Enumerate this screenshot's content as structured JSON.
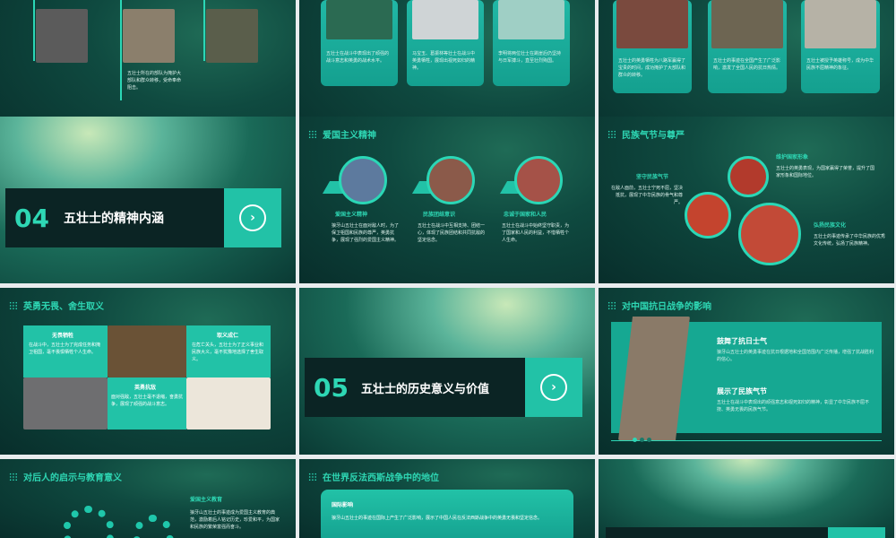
{
  "slides": {
    "s1": {
      "text": "五壮士所在的部队为掩护大部队和群众转移，受命奉命阻击。"
    },
    "s2": {
      "cards": [
        "五壮士在战斗中表现出了顽强的战斗意志和英勇的战术水平。",
        "马宝玉、葛振林等壮士在战斗中英勇牺牲，展现出视死如归的精神。",
        "李明将两位壮士在跳崖后仍坚持与日军搏斗，直至壮烈殉国。"
      ]
    },
    "s3": {
      "cards": [
        "五壮士的英勇牺牲为八路军赢得了宝贵的时间，成功掩护了大部队和群众的转移。",
        "五壮士的事迹在全国产生了广泛影响，激发了全国人民的抗日热情。",
        "五壮士被授予英雄称号，成为中华民族不屈精神的象征。"
      ]
    },
    "s4": {
      "number": "04",
      "title": "五壮士的精神内涵"
    },
    "s5": {
      "header": "爱国主义精神",
      "cols": [
        {
          "label": "爱国主义精神",
          "text": "狼牙山五壮士在面对敌人时，为了保卫祖国和民族的尊严，英勇抗争，展现了强烈的爱国主义精神。"
        },
        {
          "label": "民族团结意识",
          "text": "五壮士在战斗中互相支持、团结一心，体现了民族团结和共同抗敌的坚定信念。"
        },
        {
          "label": "忠诚于国家和人民",
          "text": "五壮士在战斗中始终坚守职责，为了国家和人民的利益，不惜牺牲个人生命。"
        }
      ]
    },
    "s6": {
      "header": "民族气节与尊严",
      "items": [
        {
          "label": "坚守民族气节",
          "text": "在敌人面前，五壮士宁死不屈，坚决抵抗，展现了中华民族的骨气和尊严。"
        },
        {
          "label": "维护国家形象",
          "text": "五壮士的英勇表现，为国家赢得了荣誉，提升了国家形象和国际地位。"
        },
        {
          "label": "弘扬民族文化",
          "text": "五壮士的事迹传承了中华民族的优秀文化传统，弘扬了民族精神。"
        }
      ]
    },
    "s7": {
      "header": "英勇无畏、舍生取义",
      "cells": [
        {
          "label": "无畏牺牲",
          "text": "在战斗中，五壮士为了完成任务和掩卫祖国，毫不畏惧牺牲个人生命。"
        },
        {
          "label": "取义成仁",
          "text": "在危亡关头，五壮士为了正义事业和民族大义，毫不犹豫地选择了舍生取义。"
        },
        {
          "label": "英勇抗敌",
          "text": "面对强敌，五壮士毫不退缩，奋勇抗争，展现了顽强的战斗意志。"
        }
      ]
    },
    "s8": {
      "number": "05",
      "title": "五壮士的历史意义与价值"
    },
    "s9": {
      "header": "对中国抗日战争的影响",
      "items": [
        {
          "label": "鼓舞了抗日士气",
          "text": "狼牙山五壮士的英勇事迹在抗日根据地和全国范围内广泛传播，增强了抗战胜利的信心。"
        },
        {
          "label": "展示了民族气节",
          "text": "五壮士在战斗中表现出的顽强意志和视死如归的精神，彰显了中华民族不屈不挠、英勇无畏的民族气节。"
        }
      ]
    },
    "s10": {
      "header": "对后人的启示与教育意义",
      "label": "爱国主义教育",
      "text": "狼牙山五壮士的事迹成为爱国主义教育的典范，激励着后人铭记历史，珍爱和平，为国家和民族的繁荣富强而奋斗。"
    },
    "s11": {
      "header": "在世界反法西斯战争中的地位",
      "label": "国际影响",
      "text": "狼牙山五壮士的事迹在国际上产生了广泛影响，展示了中国人民在反法西斯战争中的英勇无畏和坚定信念。"
    }
  },
  "colors": {
    "accent": "#22c2a7",
    "dark": "#0b2424",
    "bg": "#0f4a40"
  }
}
